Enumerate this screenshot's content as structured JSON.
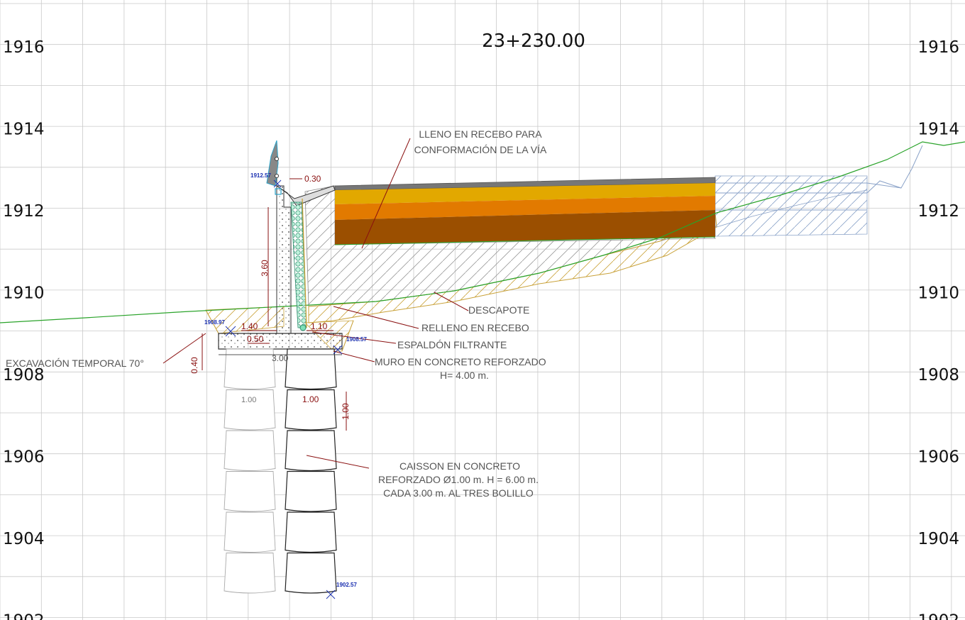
{
  "section_title": "23+230.00",
  "elevations_left": [
    "1916",
    "1914",
    "1912",
    "1910",
    "1908",
    "1906",
    "1904",
    "1902"
  ],
  "elevations_right": [
    "1916",
    "1914",
    "1912",
    "1910",
    "1908",
    "1906",
    "1904",
    "1902"
  ],
  "labels": {
    "lleno_1": "LLENO EN RECEBO PARA",
    "lleno_2": "CONFORMACIÓN DE LA VÍA",
    "descapote": "DESCAPOTE",
    "relleno": "RELLENO EN RECEBO",
    "espaldon": "ESPALDÓN FILTRANTE",
    "muro_1": "MURO EN CONCRETO REFORZADO",
    "muro_2": "H= 4.00 m.",
    "excavacion": "EXCAVACIÓN TEMPORAL 70°",
    "caisson_1": "CAISSON EN CONCRETO",
    "caisson_2": "REFORZADO Ø1.00 m. H = 6.00 m.",
    "caisson_3": "CADA 3.00 m. AL TRES BOLILLO"
  },
  "dimensions": {
    "d_030": "0.30",
    "d_360": "3.60",
    "d_140": "1.40",
    "d_110": "1.10",
    "d_050": "0.50",
    "d_300": "3.00",
    "d_040": "0.40",
    "d_100_left": "1.00",
    "d_100_right": "1.00",
    "d_100_vert": "1.00"
  },
  "points": {
    "p1": "1912.57",
    "p2": "1908.97",
    "p3": "1908.57",
    "p4": "1902.57"
  },
  "colors": {
    "grid": "#c9c9c9",
    "terrain": "#2aa32a",
    "pavement_top": "#e2a800",
    "pavement_mid": "#e27a00",
    "pavement_base": "#9b4f00",
    "dimension": "#8a1010",
    "point_label": "#1a2fb0",
    "filter": "#7ee0b8"
  }
}
